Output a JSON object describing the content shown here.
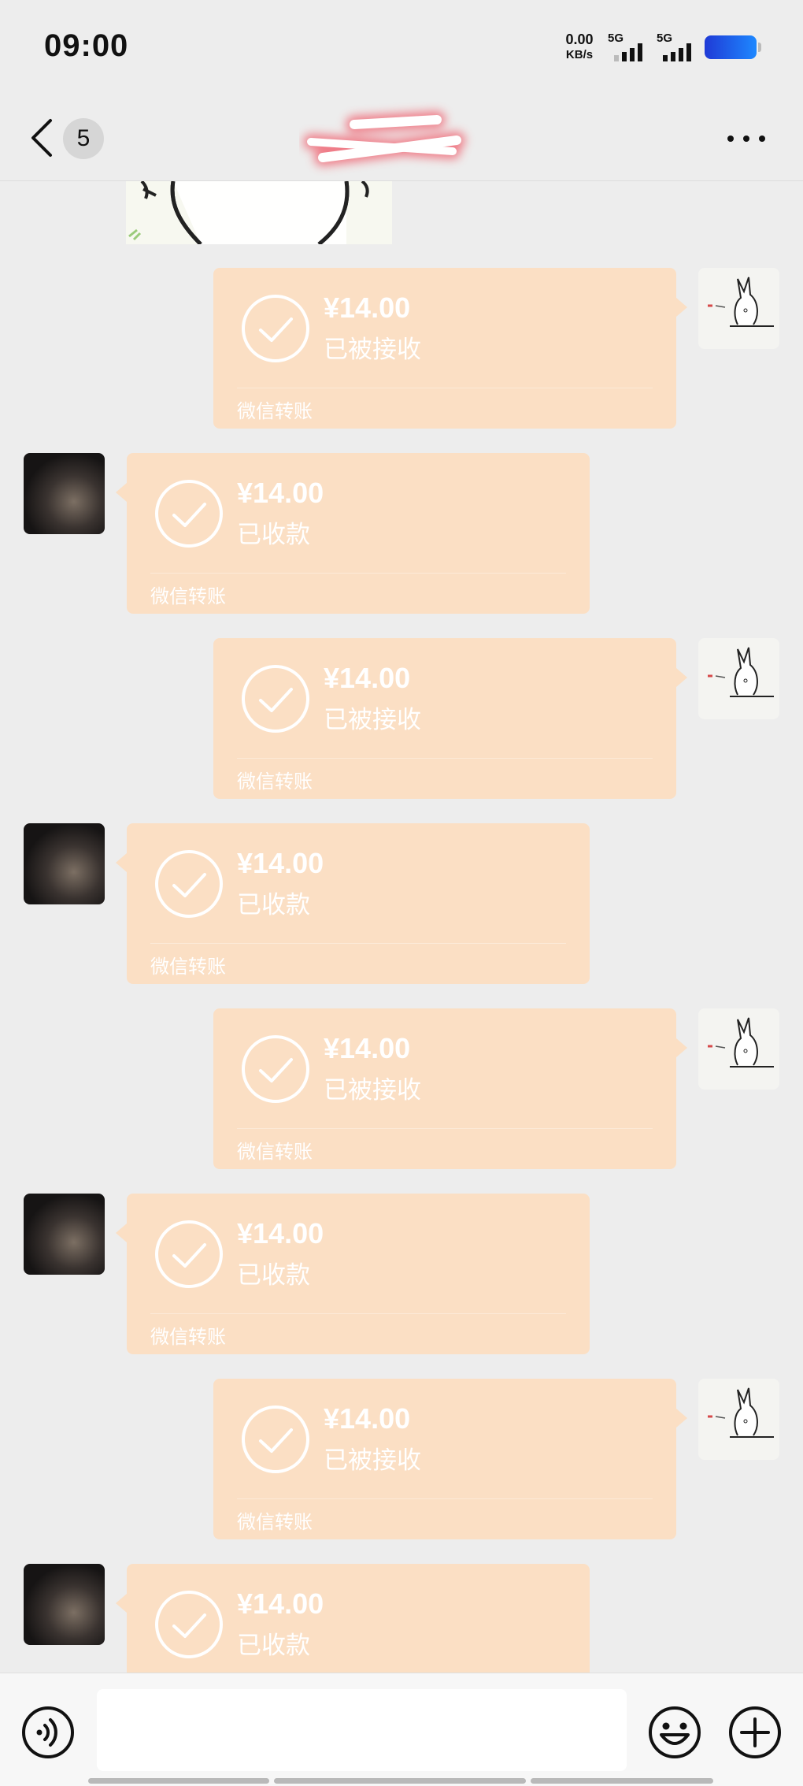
{
  "status_bar": {
    "time": "09:00",
    "net_speed_value": "0.00",
    "net_speed_unit": "KB/s",
    "signal_1_label": "5G",
    "signal_2_label": "5G"
  },
  "nav": {
    "unread_count": "5",
    "title_obscured": true
  },
  "messages": [
    {
      "side": "sent",
      "amount": "¥14.00",
      "status": "已被接收",
      "label": "微信转账"
    },
    {
      "side": "received",
      "amount": "¥14.00",
      "status": "已收款",
      "label": "微信转账"
    },
    {
      "side": "sent",
      "amount": "¥14.00",
      "status": "已被接收",
      "label": "微信转账"
    },
    {
      "side": "received",
      "amount": "¥14.00",
      "status": "已收款",
      "label": "微信转账"
    },
    {
      "side": "sent",
      "amount": "¥14.00",
      "status": "已被接收",
      "label": "微信转账"
    },
    {
      "side": "received",
      "amount": "¥14.00",
      "status": "已收款",
      "label": "微信转账"
    },
    {
      "side": "sent",
      "amount": "¥14.00",
      "status": "已被接收",
      "label": "微信转账"
    },
    {
      "side": "received",
      "amount": "¥14.00",
      "status": "已收款",
      "label": ""
    }
  ],
  "input": {
    "value": "",
    "placeholder": ""
  },
  "icons": {
    "back": "back-chevron-icon",
    "more": "more-dots-icon",
    "voice": "voice-icon",
    "emoji": "emoji-icon",
    "plus": "plus-icon",
    "check": "check-circle-icon"
  },
  "colors": {
    "background": "#ededed",
    "transfer_bubble": "#fbdfc4",
    "battery": "#1e88ff"
  }
}
